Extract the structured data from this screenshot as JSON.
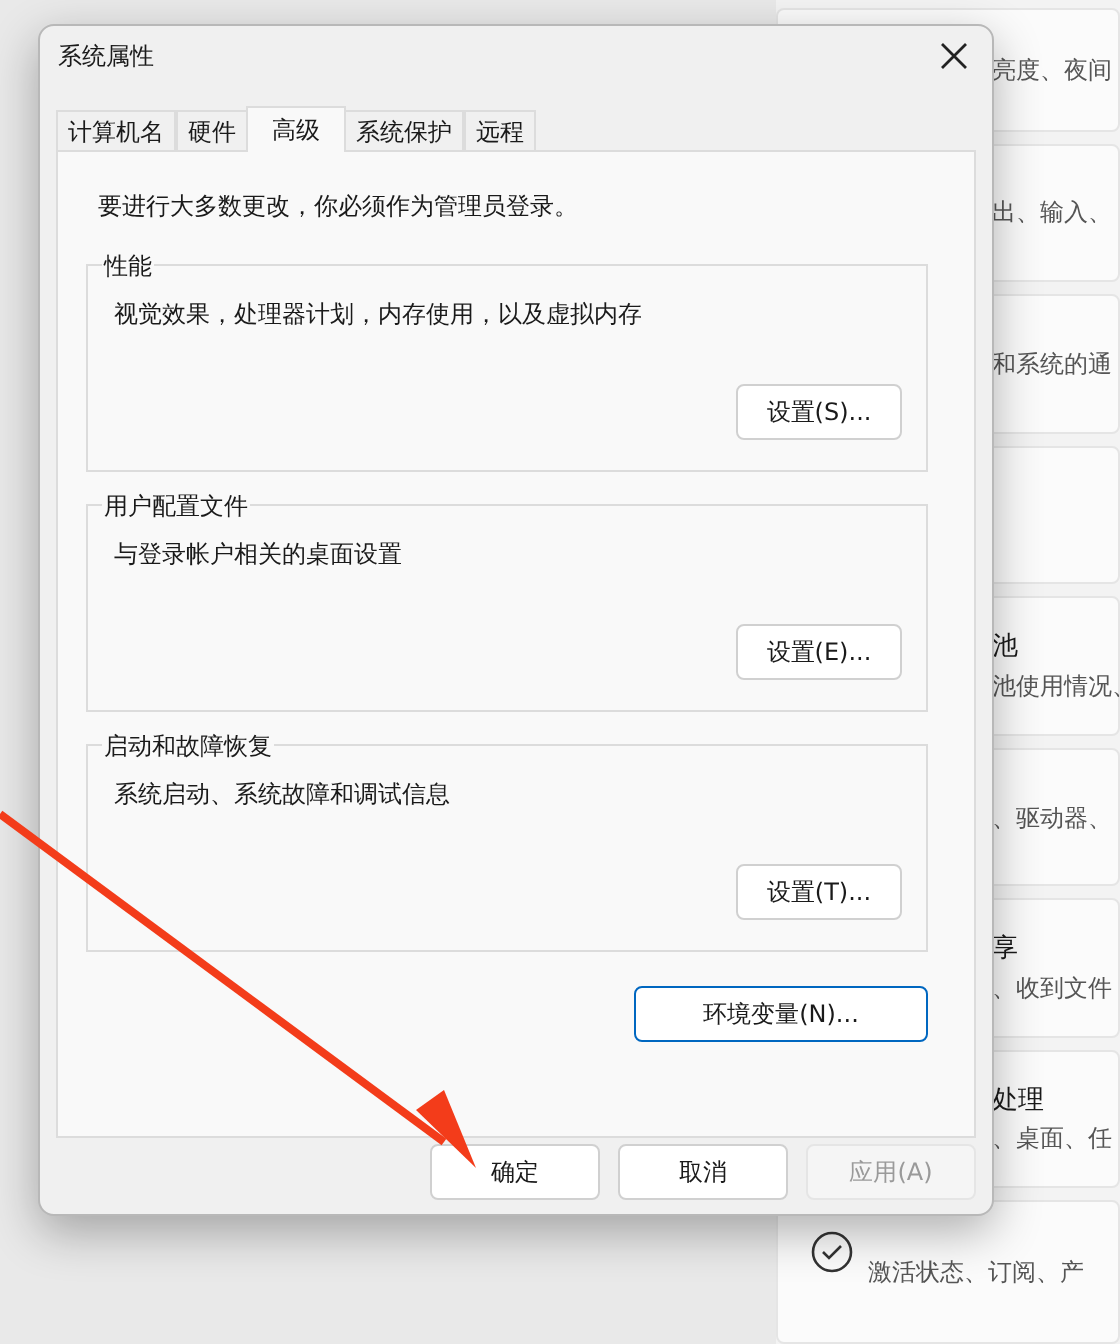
{
  "background_cards": [
    {
      "kind": "text",
      "subtitle": "亮度、夜间"
    },
    {
      "kind": "text",
      "subtitle": "出、输入、"
    },
    {
      "kind": "text",
      "subtitle": "和系统的通"
    },
    {
      "kind": "empty"
    },
    {
      "kind": "text",
      "title": "池",
      "subtitle": "池使用情况、"
    },
    {
      "kind": "text",
      "subtitle": "、驱动器、"
    },
    {
      "kind": "text",
      "title": "享",
      "subtitle": "、收到文件"
    },
    {
      "kind": "text",
      "title": "处理",
      "subtitle": "、桌面、任"
    },
    {
      "kind": "icon",
      "subtitle": "激活状态、订阅、产"
    }
  ],
  "window": {
    "title": "系统属性"
  },
  "tabs": [
    {
      "label": "计算机名",
      "selected": false
    },
    {
      "label": "硬件",
      "selected": false
    },
    {
      "label": "高级",
      "selected": true
    },
    {
      "label": "系统保护",
      "selected": false
    },
    {
      "label": "远程",
      "selected": false
    }
  ],
  "notice": "要进行大多数更改，你必须作为管理员登录。",
  "groups": [
    {
      "title": "性能",
      "description": "视觉效果，处理器计划，内存使用，以及虚拟内存",
      "button": "设置(S)..."
    },
    {
      "title": "用户配置文件",
      "description": "与登录帐户相关的桌面设置",
      "button": "设置(E)..."
    },
    {
      "title": "启动和故障恢复",
      "description": "系统启动、系统故障和调试信息",
      "button": "设置(T)..."
    }
  ],
  "env_button": {
    "label": "环境变量(N)...",
    "focused": true
  },
  "buttons": [
    {
      "label": "确定",
      "disabled": false
    },
    {
      "label": "取消",
      "disabled": false
    },
    {
      "label": "应用(A)",
      "disabled": true
    }
  ]
}
